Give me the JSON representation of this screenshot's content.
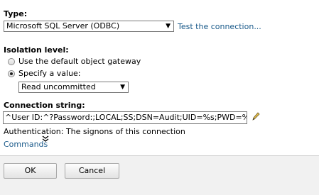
{
  "type_section": {
    "label": "Type:",
    "selected": "Microsoft SQL Server (ODBC)",
    "test_link": "Test the connection..."
  },
  "isolation": {
    "label": "Isolation level:",
    "options": [
      {
        "label": "Use the default object gateway",
        "checked": false
      },
      {
        "label": "Specify a value:",
        "checked": true
      }
    ],
    "selected": "Read uncommitted"
  },
  "connection": {
    "label": "Connection string:",
    "value": "^User ID:^?Password:;LOCAL;SS;DSN=Audit;UID=%s;PWD=%s",
    "auth_text": "Authentication: The signons of this connection"
  },
  "commands": {
    "label": "Commands"
  },
  "footer": {
    "ok_label": "OK",
    "cancel_label": "Cancel"
  },
  "colors": {
    "link": "#1a5a8a",
    "footer_bg": "#f1f1f1"
  }
}
